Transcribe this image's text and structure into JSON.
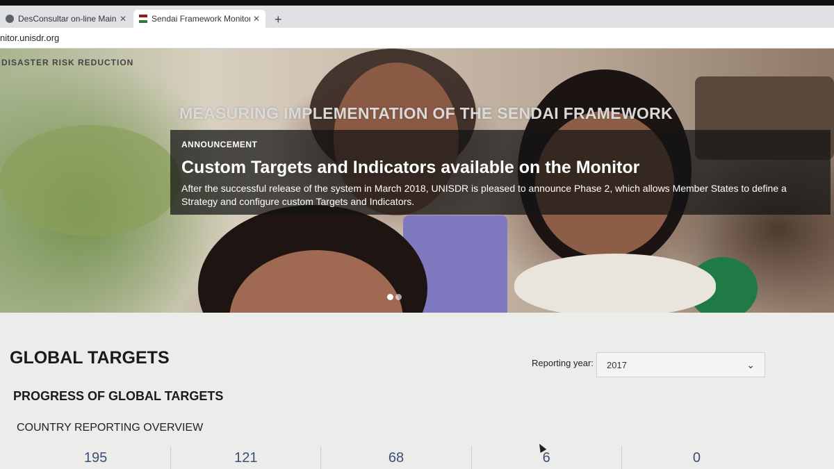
{
  "browser": {
    "tabs": [
      {
        "label": "DesConsultar on-line Main Menu",
        "close": "✕"
      },
      {
        "label": "Sendai Framework Monitor Hom",
        "close": "✕"
      }
    ],
    "new_tab": "+",
    "url": "nitor.unisdr.org"
  },
  "hero": {
    "brand": "DISASTER RISK REDUCTION",
    "heading": "MEASURING IMPLEMENTATION OF THE SENDAI FRAMEWORK",
    "announcement": {
      "label": "ANNOUNCEMENT",
      "title": "Custom Targets and Indicators available on the Monitor",
      "body": "After the successful release of the system in March 2018, UNISDR is pleased to announce Phase 2, which allows Member States to define a Strategy and configure custom Targets and Indicators."
    },
    "carousel_active_index": 0
  },
  "main": {
    "title": "GLOBAL TARGETS",
    "reporting_year_label": "Reporting year:",
    "reporting_year_value": "2017",
    "progress_title": "PROGRESS OF GLOBAL TARGETS",
    "overview_title": "COUNTRY REPORTING OVERVIEW",
    "stats": [
      "195",
      "121",
      "68",
      "6",
      "0"
    ]
  },
  "icons": {
    "select_chevron": "chevron-down-icon"
  }
}
